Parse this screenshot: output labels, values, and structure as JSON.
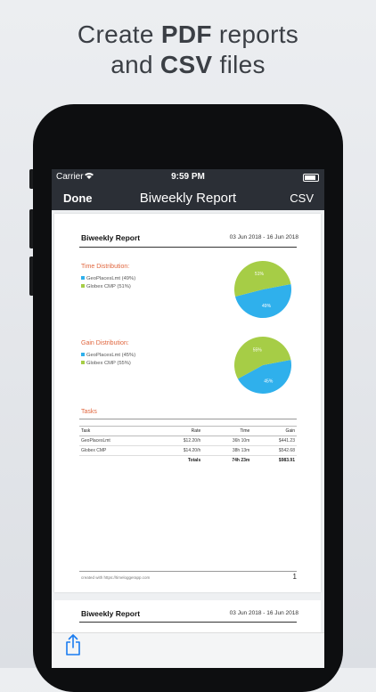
{
  "headline": {
    "line1_pre": "Create ",
    "line1_bold": "PDF",
    "line1_post": " reports",
    "line2_pre": "and ",
    "line2_bold": "CSV",
    "line2_post": " files"
  },
  "status": {
    "carrier": "Carrier",
    "time": "9:59 PM"
  },
  "nav": {
    "left": "Done",
    "title": "Biweekly Report",
    "right": "CSV"
  },
  "report": {
    "title": "Biweekly Report",
    "dates": "03 Jun 2018 - 16 Jun 2018",
    "time_section": {
      "label": "Time Distribution:",
      "legend": [
        {
          "name": "GeoPlacesLmt",
          "pct": "(49%)",
          "color": "#2fb0ec"
        },
        {
          "name": "Globex CMP",
          "pct": "(51%)",
          "color": "#a6cd46"
        }
      ],
      "slices": [
        {
          "label": "49%",
          "value": 49,
          "color": "#2fb0ec"
        },
        {
          "label": "51%",
          "value": 51,
          "color": "#a6cd46"
        }
      ]
    },
    "gain_section": {
      "label": "Gain Distribution:",
      "legend": [
        {
          "name": "GeoPlacesLmt",
          "pct": "(45%)",
          "color": "#2fb0ec"
        },
        {
          "name": "Globex CMP",
          "pct": "(55%)",
          "color": "#a6cd46"
        }
      ],
      "slices": [
        {
          "label": "45%",
          "value": 45,
          "color": "#2fb0ec"
        },
        {
          "label": "55%",
          "value": 55,
          "color": "#a6cd46"
        }
      ]
    },
    "tasks": {
      "label": "Tasks",
      "headers": [
        "Task",
        "Rate",
        "Time",
        "Gain"
      ],
      "rows": [
        [
          "GeoPlacesLmt",
          "$12.20/h",
          "36h 10m",
          "$441.23"
        ],
        [
          "Globex CMP",
          "$14.20/h",
          "38h 13m",
          "$542.68"
        ]
      ],
      "totals": [
        "",
        "Totals",
        "74h 23m",
        "$983.91"
      ]
    },
    "footer": "created with https://timeloggerapp.com",
    "page_number": "1"
  },
  "page2": {
    "title": "Biweekly Report",
    "dates": "03 Jun 2018 - 16 Jun 2018"
  },
  "icons": {
    "share": "share-icon",
    "wifi": "wifi-icon",
    "battery": "battery-icon"
  }
}
